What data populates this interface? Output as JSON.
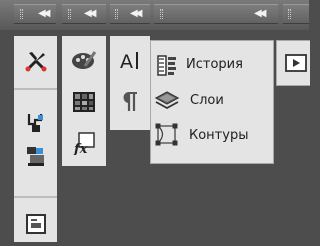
{
  "panel_bar": {
    "collapse_glyph": "◀◀"
  },
  "expanded_panel": {
    "items": [
      {
        "label": "История",
        "icon": "history-icon"
      },
      {
        "label": "Слои",
        "icon": "layers-icon"
      },
      {
        "label": "Контуры",
        "icon": "paths-icon"
      }
    ]
  },
  "icons": {
    "tools": "tools-icon",
    "brush": "brush-icon",
    "swatches": "swatches-icon",
    "fx": "fx-icon",
    "character": "character-icon",
    "paragraph": "paragraph-icon",
    "clone": "clone-source-icon",
    "tool_presets": "tool-presets-icon",
    "navigator": "navigator-icon",
    "actions": "actions-icon"
  },
  "colors": {
    "panel_bg": "#e4e4e4",
    "dock_bg": "#4d4d4d",
    "title_bar": "#686868"
  }
}
